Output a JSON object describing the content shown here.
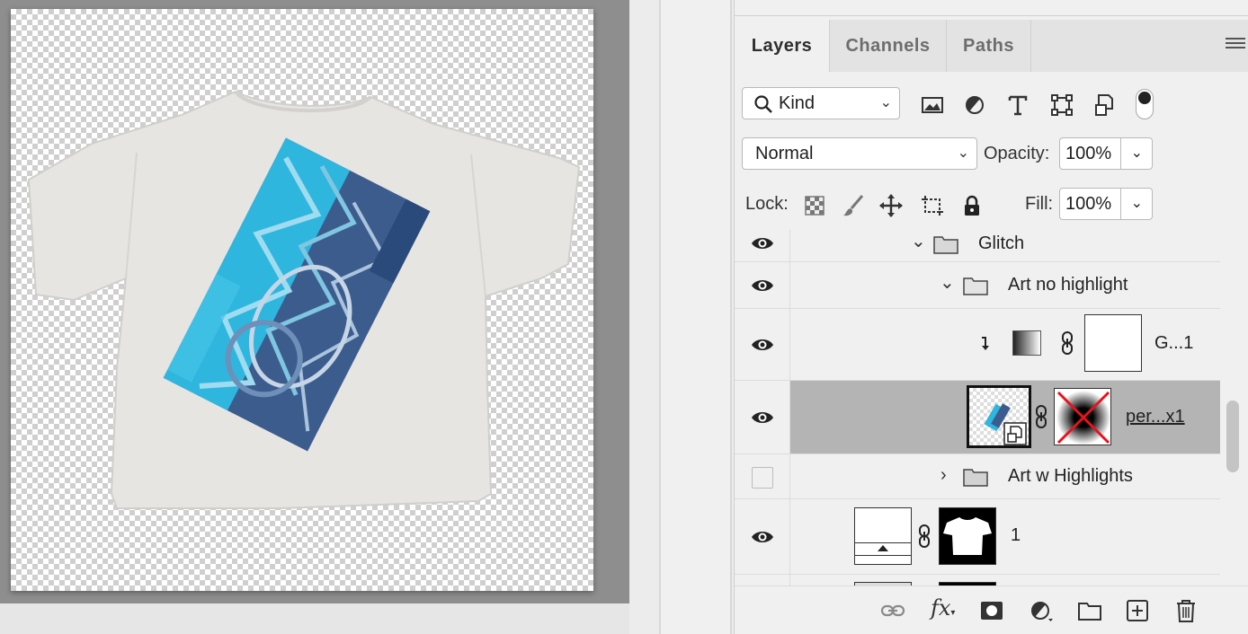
{
  "app": {
    "accent_selected_row": "#b4b4b4",
    "panel_bg": "#f0f0f0"
  },
  "tabs": [
    {
      "label": "Layers",
      "active": true
    },
    {
      "label": "Channels",
      "active": false
    },
    {
      "label": "Paths",
      "active": false
    }
  ],
  "filter": {
    "kind_label": "Kind",
    "filter_icons": [
      "image-filter-icon",
      "adjustment-filter-icon",
      "type-filter-icon",
      "shape-filter-icon",
      "smart-object-filter-icon",
      "filter-toggle-icon"
    ]
  },
  "blend": {
    "mode": "Normal",
    "opacity_label": "Opacity:",
    "opacity_value": "100%"
  },
  "lock": {
    "label": "Lock:",
    "icons": [
      "lock-transparent-icon",
      "lock-pixels-icon",
      "lock-position-icon",
      "lock-artboard-icon",
      "lock-all-icon"
    ],
    "fill_label": "Fill:",
    "fill_value": "100%"
  },
  "layers": [
    {
      "name": "Glitch",
      "type": "group",
      "expanded": true,
      "visible": true
    },
    {
      "name": "Art no highlight",
      "type": "group",
      "expanded": true,
      "visible": true
    },
    {
      "name": "G...1",
      "type": "gradient-fill",
      "visible": true,
      "clipped": true
    },
    {
      "name": "per...x1",
      "type": "smart-object",
      "visible": true,
      "selected": true
    },
    {
      "name": "Art w Highlights",
      "type": "group",
      "expanded": false,
      "visible": false
    },
    {
      "name": "1",
      "type": "fill-with-mask",
      "visible": true
    }
  ],
  "bottom_icons": [
    "link-layers-icon",
    "fx-icon",
    "add-mask-icon",
    "adjustment-layer-icon",
    "new-group-icon",
    "new-layer-icon",
    "delete-layer-icon"
  ],
  "fx_label": "fx"
}
